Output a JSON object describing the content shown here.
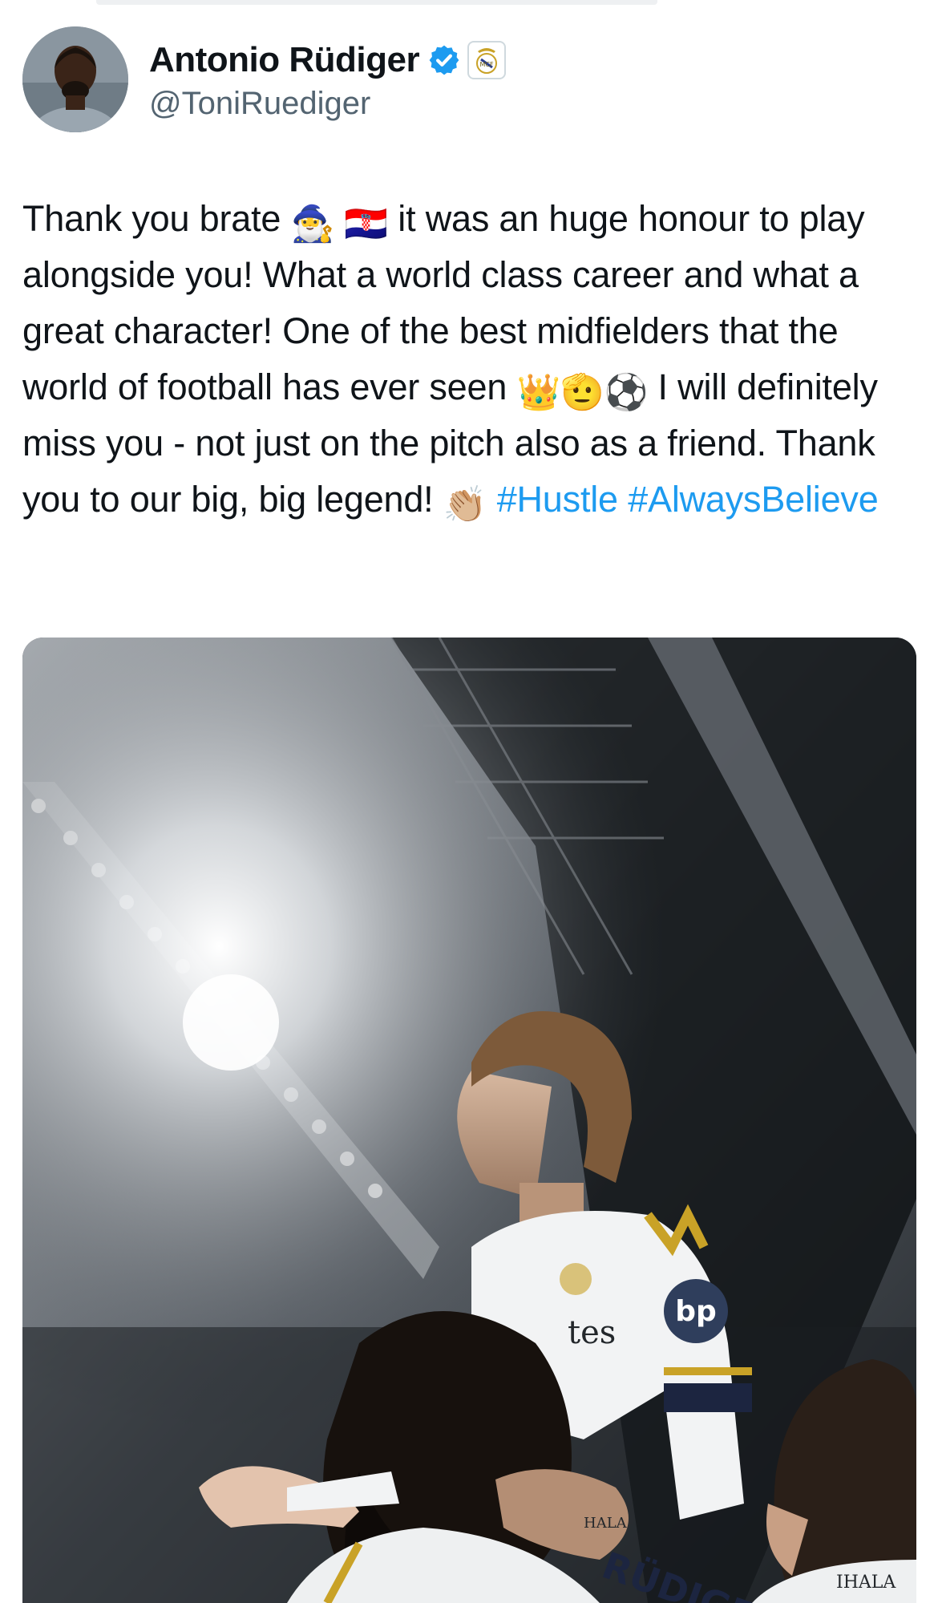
{
  "author": {
    "display_name": "Antonio Rüdiger",
    "handle": "@ToniRuediger",
    "verified": true,
    "verified_color": "#1d9bf0",
    "affiliation_badge": "real-madrid-crest-icon"
  },
  "tweet": {
    "text_1": "Thank you brate ",
    "emoji_1": "🧙‍♂️",
    "emoji_2": "🇭🇷",
    "text_2": " it was an huge honour to play alongside you! What a world class career and what a great character! One of the best midfielders that the world of football has ever seen ",
    "emoji_3": "👑",
    "emoji_4": "🫡",
    "emoji_5": "⚽",
    "text_3": " I will definitely miss you - not just on the pitch also as a friend. Thank you to our big, big legend! ",
    "emoji_6": "👏🏼",
    "hashtag_1": "#Hustle",
    "hashtag_2": "#AlwaysBelieve",
    "hashtag_color": "#1d9bf0"
  },
  "media": {
    "kind": "photo",
    "jersey_text_1": "tes",
    "jersey_text_2": "HALA",
    "jersey_text_3": "RÜDIGER",
    "jersey_text_4": "IHALA"
  }
}
